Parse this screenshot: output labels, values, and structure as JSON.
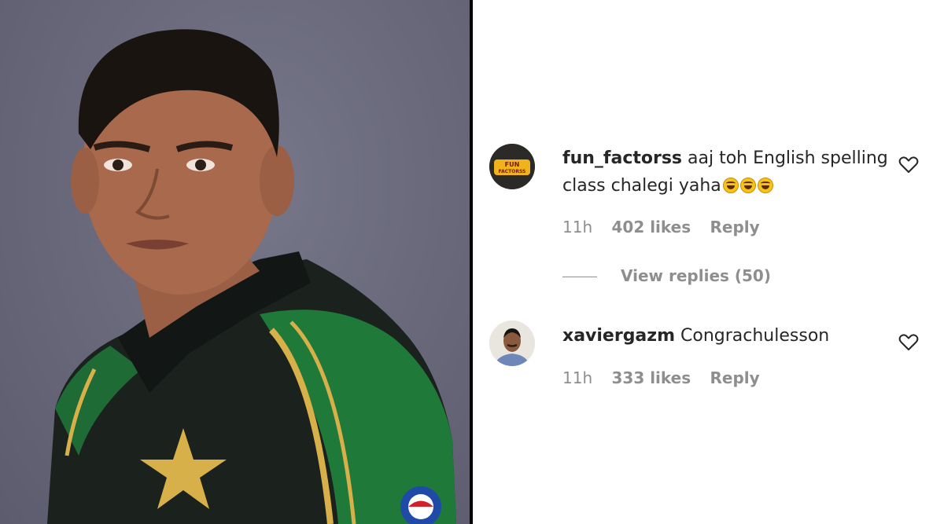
{
  "photo": {
    "description_icon": "portrait-photo"
  },
  "comments": [
    {
      "username": "fun_factorss",
      "text": "aaj toh English spelling class chalegi yaha",
      "emoji_count": 3,
      "avatar_text": "FUN FACTORSS",
      "time": "11h",
      "likes": "402 likes",
      "reply_label": "Reply",
      "liked": false
    },
    {
      "username": "xaviergazm",
      "text": "Congrachulesson",
      "time": "11h",
      "likes": "333 likes",
      "reply_label": "Reply",
      "liked": false
    }
  ],
  "view_replies": "View replies (50)",
  "colors": {
    "text": "#262626",
    "meta": "#8e8e8e",
    "jersey_green": "#1f7a3a",
    "jersey_dark": "#1b1f1c",
    "gold": "#d7b04a"
  }
}
